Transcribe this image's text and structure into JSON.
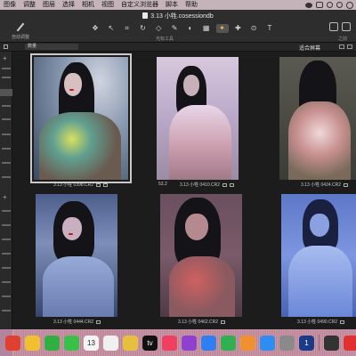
{
  "menubar": {
    "items": [
      "图像",
      "调整",
      "图层",
      "选择",
      "相机",
      "视图",
      "自定义浏览器",
      "脚本",
      "帮助"
    ],
    "status_icons": [
      "wechat-icon",
      "control-center-icon",
      "user-icon",
      "gear-icon",
      "ring-icon"
    ]
  },
  "titlebar": {
    "document_title": "3.13 小牲.cosessiondb",
    "auto_adjust_label": "自动调整",
    "tools_group_label": "光标工具",
    "right_group_label": "之前"
  },
  "viewbar": {
    "sort_value": "数量",
    "fit_screen_label": "适合屏幕"
  },
  "photos": [
    {
      "filename": "3.13 小牲 0398.CR2",
      "selected": true,
      "left_label": ""
    },
    {
      "filename": "3.13 小牲 0410.CR2",
      "selected": false,
      "left_label": "53.2"
    },
    {
      "filename": "3.13 小牲 0424.CR2",
      "selected": false,
      "left_label": ""
    },
    {
      "filename": "3.13 小牲 0444.CR2",
      "selected": false,
      "left_label": ""
    },
    {
      "filename": "3.13 小牲 0462.CR2",
      "selected": false,
      "left_label": ""
    },
    {
      "filename": "3.13 小牲 0490.CR2",
      "selected": false,
      "left_label": ""
    }
  ],
  "dock": {
    "apps": [
      {
        "name": "finder-icon",
        "color": "#e04030"
      },
      {
        "name": "chrome-icon",
        "color": "#f0c030"
      },
      {
        "name": "facetime-icon",
        "color": "#30b040"
      },
      {
        "name": "messages-icon",
        "color": "#38c048"
      },
      {
        "name": "calendar-icon",
        "color": "#f4f4f4",
        "text": "13"
      },
      {
        "name": "reminders-icon",
        "color": "#f0f0f0"
      },
      {
        "name": "notes-icon",
        "color": "#e8c040"
      },
      {
        "name": "appletv-icon",
        "color": "#111111",
        "text": "tv"
      },
      {
        "name": "music-icon",
        "color": "#f04060"
      },
      {
        "name": "podcasts-icon",
        "color": "#9040d0"
      },
      {
        "name": "keynote-icon",
        "color": "#2f7ff0"
      },
      {
        "name": "numbers-icon",
        "color": "#30b050"
      },
      {
        "name": "pages-icon",
        "color": "#f09030"
      },
      {
        "name": "appstore-icon",
        "color": "#2f8cf0"
      },
      {
        "name": "settings-icon",
        "color": "#8a8a8a"
      },
      {
        "name": "onepassword-icon",
        "color": "#1a3a8a",
        "text": "1"
      },
      {
        "name": "capture-one-icon",
        "color": "#333333"
      },
      {
        "name": "wps-icon",
        "color": "#e03030"
      },
      {
        "name": "baidu-icon",
        "color": "#f0f0f0"
      },
      {
        "name": "trash-icon",
        "color": "#c8c8d0"
      }
    ]
  }
}
